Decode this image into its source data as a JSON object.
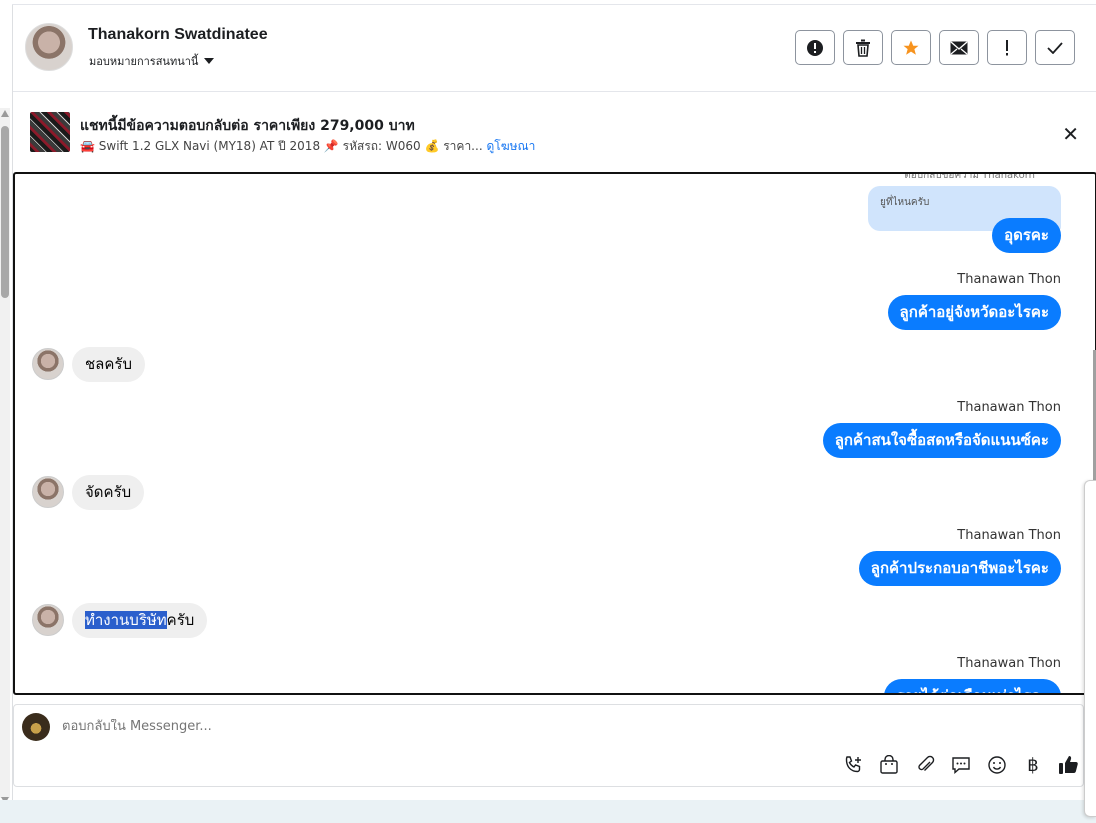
{
  "header": {
    "name": "Thanakorn Swatdinatee",
    "assign_label": "มอบหมายการสนทนานี้",
    "actions": [
      {
        "name": "report-spam-button",
        "icon": "alert-circle-icon"
      },
      {
        "name": "delete-button",
        "icon": "trash-icon"
      },
      {
        "name": "star-button",
        "icon": "star-icon"
      },
      {
        "name": "mark-unread-button",
        "icon": "envelope-icon"
      },
      {
        "name": "follow-up-button",
        "icon": "exclamation-icon"
      },
      {
        "name": "mark-done-button",
        "icon": "check-icon"
      }
    ]
  },
  "ad_banner": {
    "title": "แชทนี้มีข้อความตอบกลับต่อ ราคาเพียง 279,000 บาท",
    "subtitle": "🚘 Swift 1.2 GLX Navi (MY18) AT ปี 2018 📌 รหัสรถ: W060 💰 ราคา...",
    "link": "ดูโฆษณา"
  },
  "chat": {
    "cut_top_text": "ตอบกลับข้อความ Thanakorn",
    "reply_quote": "ยูที่ไหนครับ",
    "messages": {
      "m1": {
        "text": "อุดรคะ"
      },
      "m2": {
        "sender": "Thanawan Thon",
        "text": "ลูกค้าอยู่จังหวัดอะไรคะ"
      },
      "m3": {
        "text": "ชลครับ"
      },
      "m4": {
        "sender": "Thanawan Thon",
        "text": "ลูกค้าสนใจซื้อสดหรือจัดแนนซ์คะ"
      },
      "m5": {
        "text": "จัดครับ"
      },
      "m6": {
        "sender": "Thanawan Thon",
        "text": "ลูกค้าประกอบอาชีพอะไรคะ"
      },
      "m7": {
        "highlight": "ทำงานบริษัท",
        "rest": "ครับ"
      },
      "m8": {
        "sender": "Thanawan Thon",
        "text": "รายได้ต่อเดือนเท่าไรคะ"
      }
    }
  },
  "composer": {
    "placeholder": "ตอบกลับใน Messenger...",
    "tools": [
      "call-icon",
      "shopping-bag-icon",
      "paperclip-icon",
      "saved-reply-icon",
      "emoji-icon",
      "baht-icon",
      "thumbs-up-icon"
    ]
  },
  "colors": {
    "outgoing_bubble": "#0a7cff",
    "incoming_bubble": "#efefef",
    "star": "#f7931e",
    "link": "#1877f2"
  }
}
